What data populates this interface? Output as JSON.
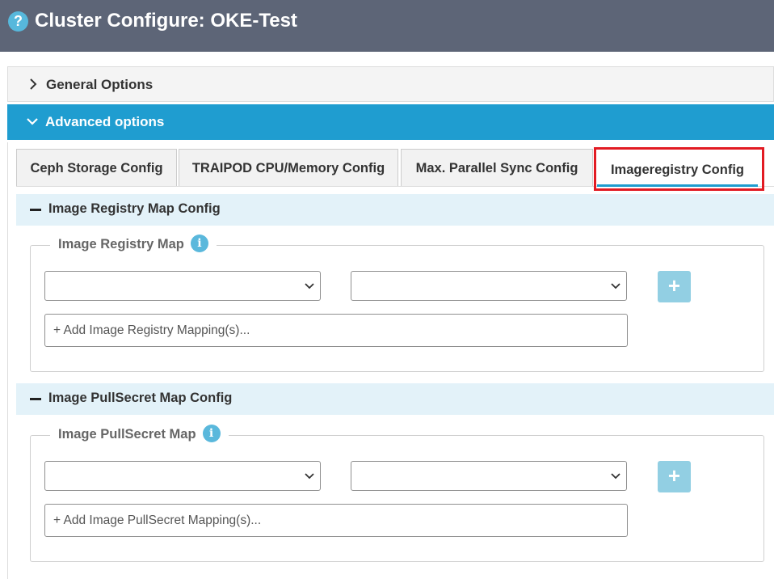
{
  "window": {
    "title": "Cluster Configure: OKE-Test",
    "help_icon": "?"
  },
  "accordion": {
    "general": {
      "label": "General Options",
      "expanded": false
    },
    "advanced": {
      "label": "Advanced options",
      "expanded": true
    }
  },
  "tabs": [
    {
      "label": "Ceph Storage Config",
      "active": false
    },
    {
      "label": "TRAIPOD CPU/Memory Config",
      "active": false
    },
    {
      "label": "Max. Parallel Sync Config",
      "active": false
    },
    {
      "label": "Imageregistry Config",
      "active": true
    }
  ],
  "sections": {
    "registry": {
      "header": "Image Registry Map Config",
      "legend": "Image Registry Map",
      "select_left_value": "",
      "select_right_value": "",
      "add_button": "+",
      "input_placeholder": "+ Add Image Registry Mapping(s)..."
    },
    "pullsecret": {
      "header": "Image PullSecret Map Config",
      "legend": "Image PullSecret Map",
      "select_left_value": "",
      "select_right_value": "",
      "add_button": "+",
      "input_placeholder": "+ Add Image PullSecret Mapping(s)..."
    }
  },
  "colors": {
    "titlebar": "#5d6577",
    "accent": "#1f9dd0",
    "section_bg": "#e3f2f9",
    "highlight": "#e21b23",
    "add_button": "#92cfe3"
  },
  "icons": {
    "help": "help-circle-icon",
    "chevron_right": "chevron-right-icon",
    "chevron_down": "chevron-down-icon",
    "collapse": "minus-icon",
    "info": "info-icon",
    "select_caret": "caret-down-icon",
    "add": "plus-icon"
  }
}
